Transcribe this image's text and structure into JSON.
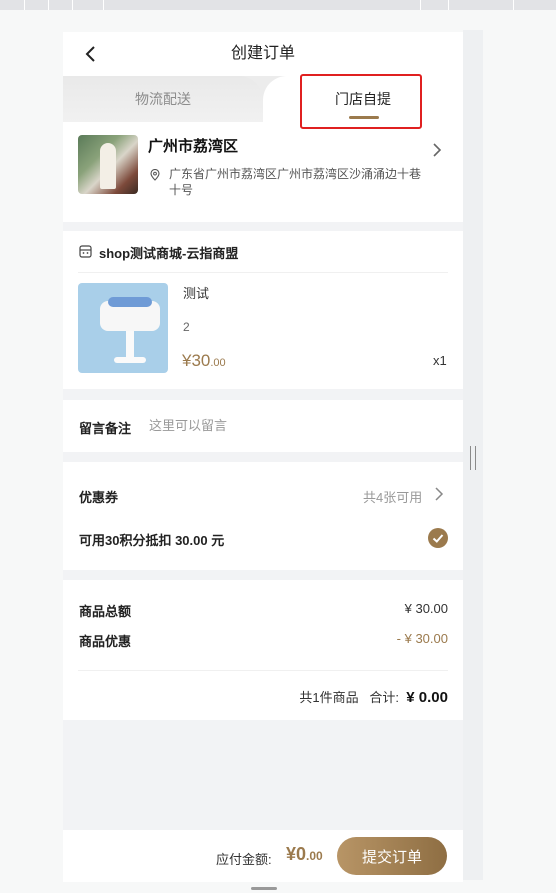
{
  "nav": {
    "title": "创建订单"
  },
  "tabs": {
    "delivery": "物流配送",
    "pickup": "门店自提"
  },
  "store": {
    "name": "广州市荔湾区",
    "address": "广东省广州市荔湾区广州市荔湾区沙涌涌边十巷十号"
  },
  "shop": {
    "name": "shop测试商城-云指商盟",
    "product": {
      "name": "测试",
      "spec": "2",
      "price_int": "¥30",
      "price_dec": ".00",
      "qty": "x1"
    }
  },
  "remark": {
    "label": "留言备注",
    "placeholder": "这里可以留言"
  },
  "coupon": {
    "label": "优惠券",
    "count": "共4张可用",
    "points": "可用30积分抵扣 30.00 元"
  },
  "summary": {
    "goods_total_label": "商品总额",
    "goods_total": "¥ 30.00",
    "goods_discount_label": "商品优惠",
    "goods_discount": "- ¥ 30.00",
    "items_count": "共1件商品",
    "subtotal_label": "合计:",
    "subtotal": "¥ 0.00"
  },
  "footer": {
    "pay_label": "应付金额:",
    "pay_int": "¥0",
    "pay_dec": ".00",
    "submit": "提交订单"
  },
  "colors": {
    "accent": "#9b7a4d",
    "highlight": "#e02020"
  }
}
